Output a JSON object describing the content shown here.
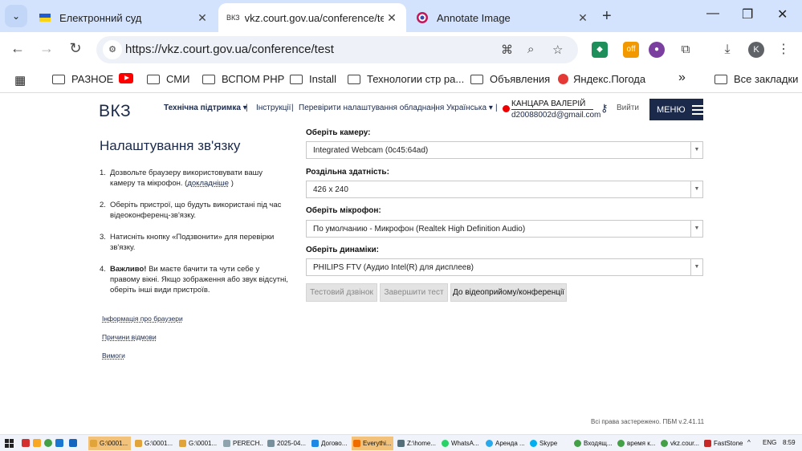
{
  "browser": {
    "tabs": [
      {
        "title": "Електронний суд",
        "favicon": "ukraine-flag-icon",
        "close": "✕"
      },
      {
        "title": "vkz.court.gov.ua/conference/tes",
        "favicon_text": "ВКЗ",
        "close": "✕"
      },
      {
        "title": "Annotate Image",
        "favicon": "annotate-icon",
        "close": "✕"
      }
    ],
    "new_tab": "+",
    "url": "https://vkz.court.gov.ua/conference/test",
    "bookmarks": [
      {
        "label": "РАЗНОЕ",
        "icon": "folder-icon"
      },
      {
        "label": "",
        "icon": "youtube-icon"
      },
      {
        "label": "СМИ",
        "icon": "folder-icon"
      },
      {
        "label": "ВСПОМ PHP",
        "icon": "folder-icon"
      },
      {
        "label": "Install",
        "icon": "folder-icon"
      },
      {
        "label": "Технологии стр ра...",
        "icon": "folder-icon"
      },
      {
        "label": "Объявления",
        "icon": "folder-icon"
      },
      {
        "label": "Яндекс.Погода",
        "icon": "weather-icon"
      }
    ],
    "all_bookmarks": "Все закладки",
    "more_bookmarks": "»",
    "profile_initial": "K",
    "ext_badge": "off"
  },
  "header": {
    "logo": "ВКЗ",
    "support": "Технічна підтримка",
    "instructions": "Інструкції",
    "check_settings": "Перевірити налаштування обладнання",
    "language": "Українська",
    "user_name": "КАНЦАРА ВАЛЕРІЙ",
    "user_email": "d20088002d@gmail.com",
    "logout": "Вийти",
    "menu": "МЕНЮ"
  },
  "left": {
    "title": "Налаштування зв'язку",
    "step1_text": "Дозвольте браузеру використовувати вашу камеру та мікрофон. (",
    "step1_link": "докладніше",
    "step1_end": " )",
    "step2": "Оберіть пристрої, що будуть використані під час відеоконференц-зв'язку.",
    "step3": "Натисніть кнопку «Подзвонити» для перевірки зв'язку.",
    "step4_bold": "Важливо!",
    "step4": " Ви маєте бачити та чути себе у правому вікні. Якщо зображення або звук відсутні, оберіть інші види пристроїв.",
    "links": [
      "Інформація про браузери",
      "Причини відмови",
      "Вимоги"
    ]
  },
  "form": {
    "camera_label": "Оберіть камеру:",
    "camera_value": "Integrated Webcam (0c45:64ad)",
    "resolution_label": "Роздільна здатність:",
    "resolution_value": "426 x 240",
    "mic_label": "Оберіть мікрофон:",
    "mic_value": "По умолчанию - Микрофон (Realtek High Definition Audio)",
    "speaker_label": "Оберіть динаміки:",
    "speaker_value": "PHILIPS FTV (Аудио Intel(R) для дисплеев)",
    "btn_test_call": "Тестовий дзвінок",
    "btn_end_test": "Завершити тест",
    "btn_go_conference": "До відеоприйому/конференції"
  },
  "footer": {
    "copyright": "Всі права застережено. ПБМ v.2.41.11"
  },
  "taskbar": {
    "items": [
      "G:\\0001...",
      "G:\\0001...",
      "G:\\0001...",
      "PERECH...",
      "2025-04...",
      "Догово...",
      "Everythi...",
      "Z:\\home...",
      "WhatsA...",
      "Аренда ...",
      "Skype",
      "Входящ...",
      "время к...",
      "vkz.cour...",
      "FastStone"
    ],
    "lang": "ENG",
    "time": "8:59"
  }
}
